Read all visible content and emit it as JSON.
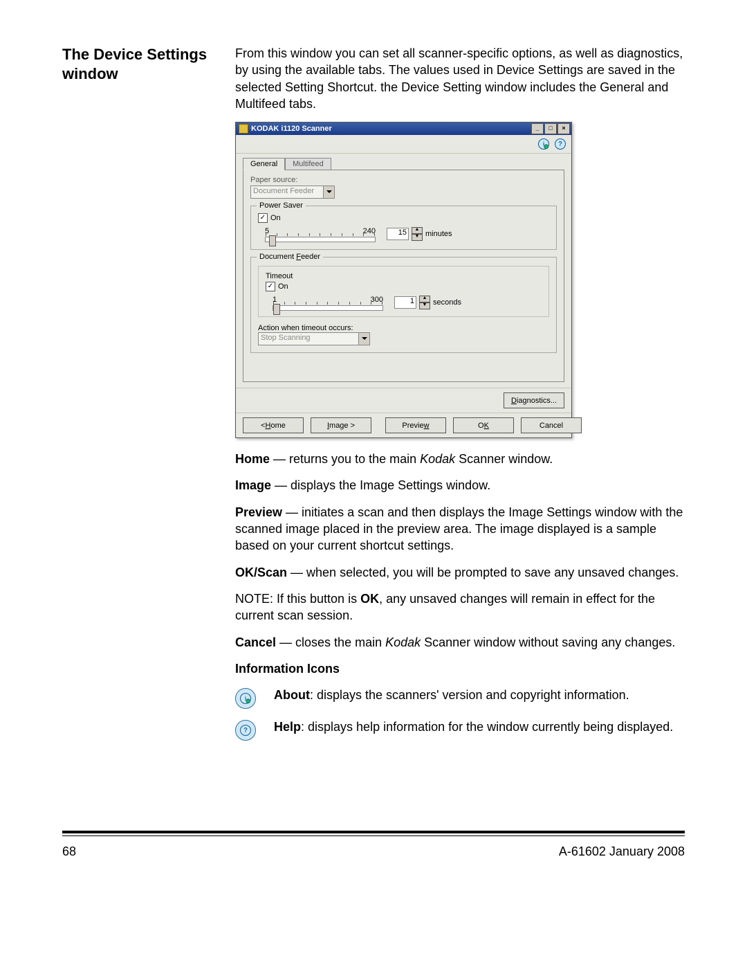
{
  "section_title": "The Device Settings window",
  "intro": "From this window you can set all scanner-specific options, as well as diagnostics, by using the available tabs. The values used in Device Settings are saved in the selected Setting Shortcut. the Device Setting window includes the General and Multifeed tabs.",
  "dialog": {
    "title": "KODAK i1120 Scanner",
    "win_controls": {
      "min": "_",
      "max": "□",
      "close": "×"
    },
    "toolbar_icons": {
      "about": "about-icon",
      "help": "help-icon"
    },
    "tabs": {
      "general": "General",
      "multifeed": "Multifeed"
    },
    "paper_source_label": "Paper source:",
    "paper_source_value": "Document Feeder",
    "power_saver": {
      "legend": "Power Saver",
      "on_label": "On",
      "on_checked": "✓",
      "slider_min": "5",
      "slider_max": "240",
      "value": "15",
      "unit": "minutes"
    },
    "doc_feeder": {
      "legend": "Document Feeder",
      "timeout_label": "Timeout",
      "on_label": "On",
      "on_checked": "✓",
      "slider_min": "1",
      "slider_max": "300",
      "value": "1",
      "unit": "seconds",
      "action_label": "Action when timeout occurs:",
      "action_value": "Stop Scanning"
    },
    "diagnostics_btn": "Diagnostics...",
    "footer": {
      "home": "< Home",
      "image": "Image >",
      "preview": "Preview",
      "ok": "OK",
      "cancel": "Cancel"
    }
  },
  "desc": {
    "home_b": "Home",
    "home_t": " — returns you to the main ",
    "home_em": "Kodak",
    "home_t2": " Scanner window.",
    "image_b": "Image",
    "image_t": " — displays the Image Settings window.",
    "preview_b": "Preview",
    "preview_t": " — initiates a scan and then displays the Image Settings window with the scanned image placed in the preview area. The image displayed is a sample based on your current shortcut settings.",
    "okscan_b": "OK/Scan",
    "okscan_t": " — when selected, you will be prompted to save any unsaved changes.",
    "note_pre": "NOTE: If this button is ",
    "note_b": "OK",
    "note_post": ", any unsaved changes will remain in effect for the current scan session.",
    "cancel_b": "Cancel",
    "cancel_t": " — closes the main ",
    "cancel_em": "Kodak",
    "cancel_t2": " Scanner window without saving any changes.",
    "info_header": "Information Icons",
    "about_b": "About",
    "about_t": ": displays the scanners' version and copyright information.",
    "help_b": "Help",
    "help_t": ": displays help information for the window currently being displayed."
  },
  "footer": {
    "page": "68",
    "docid": "A-61602  January 2008"
  }
}
